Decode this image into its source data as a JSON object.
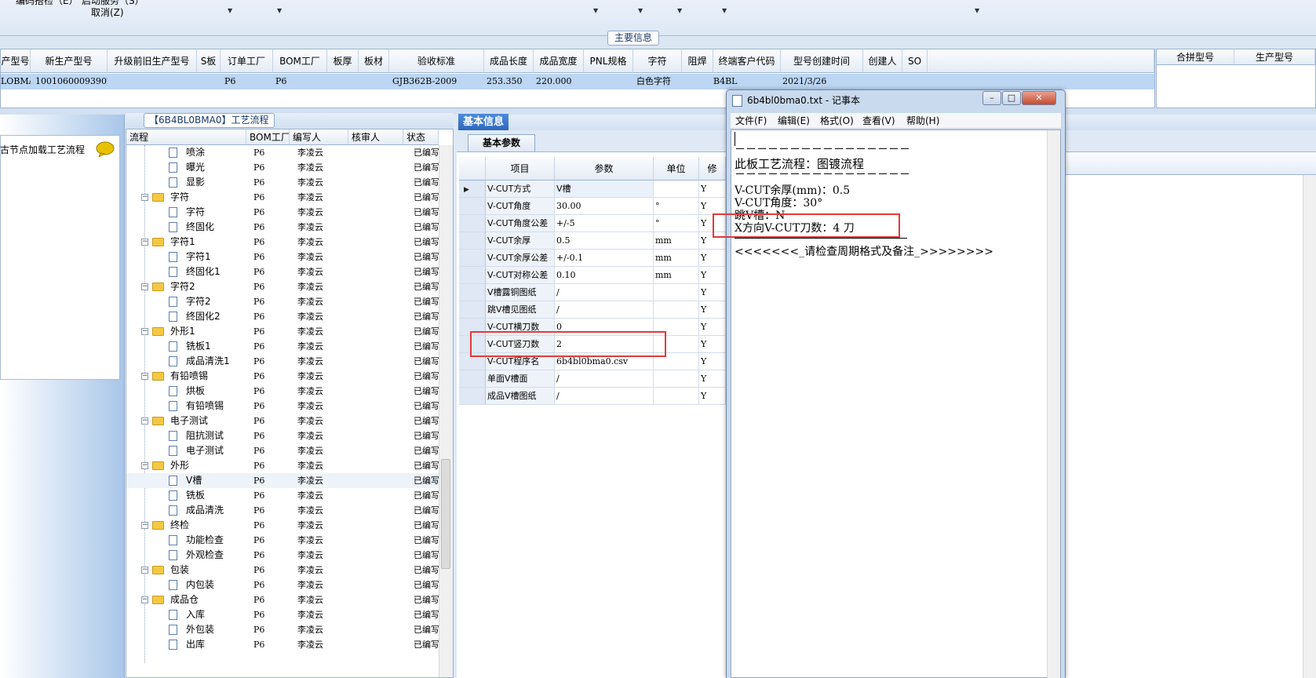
{
  "top_filter": {
    "cutoff_text_1": "编码搭检（E）",
    "cutoff_text_2": "启动服务（S）",
    "cancel_label": "取消(Z)",
    "dropdown_arrow": "▼"
  },
  "main_info": {
    "tab_label": "主要信息"
  },
  "product_grid": {
    "headers": [
      "产型号",
      "新生产型号",
      "升级前旧生产型号",
      "S板",
      "订单工厂",
      "BOM工厂",
      "板厚",
      "板材",
      "验收标准",
      "成品长度",
      "成品宽度",
      "PNL规格",
      "字符",
      "阻焊",
      "终端客户代码",
      "型号创建时间",
      "创建人",
      "SO"
    ],
    "row": [
      "LOBMAO",
      "10010600093902",
      "",
      "",
      "P6",
      "P6",
      "",
      "",
      "GJB362B-2009",
      "253.350",
      "220.000",
      "",
      "白色字符",
      "",
      "B4BL",
      "2021/3/26",
      "",
      ""
    ]
  },
  "right_grid": {
    "headers": [
      "合拼型号",
      "生产型号"
    ]
  },
  "left_panel": {
    "node_load_text": "古节点加载工艺流程"
  },
  "process": {
    "title": "【6B4BL0BMA0】工艺流程",
    "headers": [
      "流程",
      "BOM工厂",
      "编写人",
      "核审人",
      "状态"
    ],
    "rows": [
      {
        "name": "喷涂",
        "factory": "P6",
        "writer": "李凌云",
        "status": "已编写"
      },
      {
        "name": "曝光",
        "factory": "P6",
        "writer": "李凌云",
        "status": "已编写"
      },
      {
        "name": "显影",
        "factory": "P6",
        "writer": "李凌云",
        "status": "已编写"
      },
      {
        "name": "字符",
        "factory": "P6",
        "writer": "李凌云",
        "status": "已编写"
      },
      {
        "name": "字符",
        "factory": "P6",
        "writer": "李凌云",
        "status": "已编写"
      },
      {
        "name": "终固化",
        "factory": "P6",
        "writer": "李凌云",
        "status": "已编写"
      },
      {
        "name": "字符1",
        "factory": "P6",
        "writer": "李凌云",
        "status": "已编写"
      },
      {
        "name": "字符1",
        "factory": "P6",
        "writer": "李凌云",
        "status": "已编写"
      },
      {
        "name": "终固化1",
        "factory": "P6",
        "writer": "李凌云",
        "status": "已编写"
      },
      {
        "name": "字符2",
        "factory": "P6",
        "writer": "李凌云",
        "status": "已编写"
      },
      {
        "name": "字符2",
        "factory": "P6",
        "writer": "李凌云",
        "status": "已编写"
      },
      {
        "name": "终固化2",
        "factory": "P6",
        "writer": "李凌云",
        "status": "已编写"
      },
      {
        "name": "外形1",
        "factory": "P6",
        "writer": "李凌云",
        "status": "已编写"
      },
      {
        "name": "铣板1",
        "factory": "P6",
        "writer": "李凌云",
        "status": "已编写"
      },
      {
        "name": "成品清洗1",
        "factory": "P6",
        "writer": "李凌云",
        "status": "已编写"
      },
      {
        "name": "有铅喷锡",
        "factory": "P6",
        "writer": "李凌云",
        "status": "已编写"
      },
      {
        "name": "烘板",
        "factory": "P6",
        "writer": "李凌云",
        "status": "已编写"
      },
      {
        "name": "有铅喷锡",
        "factory": "P6",
        "writer": "李凌云",
        "status": "已编写"
      },
      {
        "name": "电子测试",
        "factory": "P6",
        "writer": "李凌云",
        "status": "已编写"
      },
      {
        "name": "阻抗测试",
        "factory": "P6",
        "writer": "李凌云",
        "status": "已编写"
      },
      {
        "name": "电子测试",
        "factory": "P6",
        "writer": "李凌云",
        "status": "已编写"
      },
      {
        "name": "外形",
        "factory": "P6",
        "writer": "李凌云",
        "status": "已编写"
      },
      {
        "name": "V槽",
        "factory": "P6",
        "writer": "李凌云",
        "status": "已编写"
      },
      {
        "name": "铣板",
        "factory": "P6",
        "writer": "李凌云",
        "status": "已编写"
      },
      {
        "name": "成品清洗",
        "factory": "P6",
        "writer": "李凌云",
        "status": "已编写"
      },
      {
        "name": "终检",
        "factory": "P6",
        "writer": "李凌云",
        "status": "已编写"
      },
      {
        "name": "功能检查",
        "factory": "P6",
        "writer": "李凌云",
        "status": "已编写"
      },
      {
        "name": "外观检查",
        "factory": "P6",
        "writer": "李凌云",
        "status": "已编写"
      },
      {
        "name": "包装",
        "factory": "P6",
        "writer": "李凌云",
        "status": "已编写"
      },
      {
        "name": "内包装",
        "factory": "P6",
        "writer": "李凌云",
        "status": "已编写"
      },
      {
        "name": "成品仓",
        "factory": "P6",
        "writer": "李凌云",
        "status": "已编写"
      },
      {
        "name": "入库",
        "factory": "P6",
        "writer": "李凌云",
        "status": "已编写"
      },
      {
        "name": "外包装",
        "factory": "P6",
        "writer": "李凌云",
        "status": "已编写"
      },
      {
        "name": "出库",
        "factory": "P6",
        "writer": "李凌云",
        "status": "已编写"
      }
    ]
  },
  "basic_info": {
    "tab_label": "基本信息",
    "sub_tab_label": "基本参数",
    "headers": [
      "项目",
      "参数",
      "单位",
      "修"
    ],
    "rows": [
      {
        "item": "V-CUT方式",
        "param": "V槽",
        "unit": "",
        "flag": "Y"
      },
      {
        "item": "V-CUT角度",
        "param": "30.00",
        "unit": "°",
        "flag": "Y"
      },
      {
        "item": "V-CUT角度公差",
        "param": "+/-5",
        "unit": "°",
        "flag": "Y"
      },
      {
        "item": "V-CUT余厚",
        "param": "0.5",
        "unit": "mm",
        "flag": "Y"
      },
      {
        "item": "V-CUT余厚公差",
        "param": "+/-0.1",
        "unit": "mm",
        "flag": "Y"
      },
      {
        "item": "V-CUT对称公差",
        "param": "0.10",
        "unit": "mm",
        "flag": "Y"
      },
      {
        "item": "V槽露铜图纸",
        "param": "/",
        "unit": "",
        "flag": "Y"
      },
      {
        "item": "跳V槽见图纸",
        "param": "/",
        "unit": "",
        "flag": "Y"
      },
      {
        "item": "V-CUT横刀数",
        "param": "0",
        "unit": "",
        "flag": "Y"
      },
      {
        "item": "V-CUT竖刀数",
        "param": "2",
        "unit": "",
        "flag": "Y"
      },
      {
        "item": "V-CUT程序名",
        "param": "6b4bl0bma0.csv",
        "unit": "",
        "flag": "Y"
      },
      {
        "item": "单面V槽面",
        "param": "/",
        "unit": "",
        "flag": "Y"
      },
      {
        "item": "成品V槽图纸",
        "param": "/",
        "unit": "",
        "flag": "Y"
      }
    ]
  },
  "notepad": {
    "title": "6b4bl0bma0.txt - 记事本",
    "menu": [
      "文件(F)",
      "编辑(E)",
      "格式(O)",
      "查看(V)",
      "帮助(H)"
    ],
    "lines": [
      "－－－－－－－－－－－－－－－－",
      "此板工艺流程：图镀流程",
      "－－－－－－－－－－－－－－－－",
      "V-CUT余厚(mm)：0.5",
      "V-CUT角度：30°",
      "跳V槽：N",
      "X方向V-CUT刀数：4 刀",
      "<<<<<<<_请检查周期格式及备注_>>>>>>>>"
    ]
  },
  "colors": {
    "highlight_red": "#e23a3a",
    "selection_blue": "#bcd6f3",
    "tab_blue": "#2c67bd"
  }
}
